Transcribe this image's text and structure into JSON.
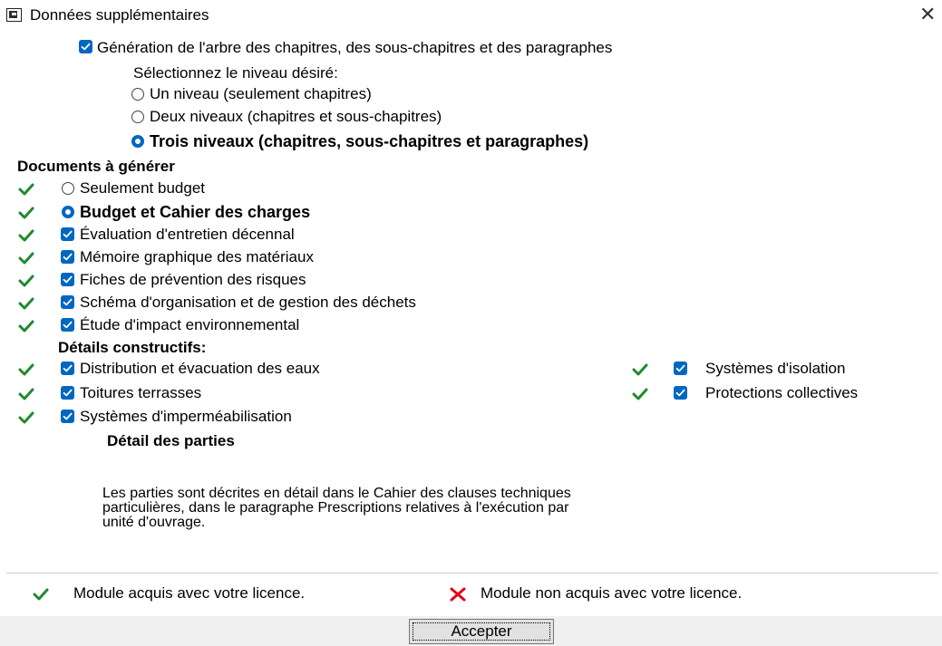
{
  "window": {
    "title": "Données supplémentaires",
    "close_glyph": "✕",
    "icon": "app-window-icon"
  },
  "tree": {
    "generate_label": "Génération de l'arbre des chapitres, des sous-chapitres et des paragraphes",
    "generate_checked": true,
    "select_level_label": "Sélectionnez le niveau désiré:",
    "levels": [
      {
        "label": "Un niveau (seulement chapitres)",
        "selected": false
      },
      {
        "label": "Deux niveaux (chapitres et sous-chapitres)",
        "selected": false
      },
      {
        "label": "Trois niveaux (chapitres, sous-chapitres et paragraphes)",
        "selected": true
      }
    ]
  },
  "documents": {
    "heading": "Documents à générer",
    "options": [
      {
        "label": "Seulement budget",
        "selected": false
      },
      {
        "label": "Budget et Cahier des charges",
        "selected": true
      }
    ],
    "items": [
      {
        "label": "Évaluation d'entretien décennal",
        "checked": true
      },
      {
        "label": "Mémoire graphique des matériaux",
        "checked": true
      },
      {
        "label": "Fiches de prévention des risques",
        "checked": true
      },
      {
        "label": "Schéma d'organisation et de gestion des déchets",
        "checked": true
      },
      {
        "label": "Étude d'impact environnemental",
        "checked": true
      }
    ]
  },
  "details": {
    "heading": "Détails constructifs:",
    "left": [
      {
        "label": "Distribution et évacuation des eaux",
        "checked": true
      },
      {
        "label": "Toitures terrasses",
        "checked": true
      },
      {
        "label": "Systèmes d'imperméabilisation",
        "checked": true
      }
    ],
    "right": [
      {
        "label": "Systèmes d'isolation",
        "checked": true
      },
      {
        "label": "Protections collectives",
        "checked": true
      }
    ]
  },
  "parts": {
    "heading": "Détail des parties",
    "description_lines": [
      "Les parties sont décrites en détail dans le Cahier des clauses techniques",
      "particulières, dans le paragraphe Prescriptions relatives à l'exécution par",
      "unité d'ouvrage."
    ]
  },
  "legend": {
    "acquired": "Module acquis avec votre licence.",
    "not_acquired": "Module non acquis avec votre licence."
  },
  "colors": {
    "check_green": "#1f8a2e",
    "cross_red": "#e2001a",
    "accent_blue": "#0067c0"
  },
  "buttons": {
    "accept": "Accepter"
  }
}
